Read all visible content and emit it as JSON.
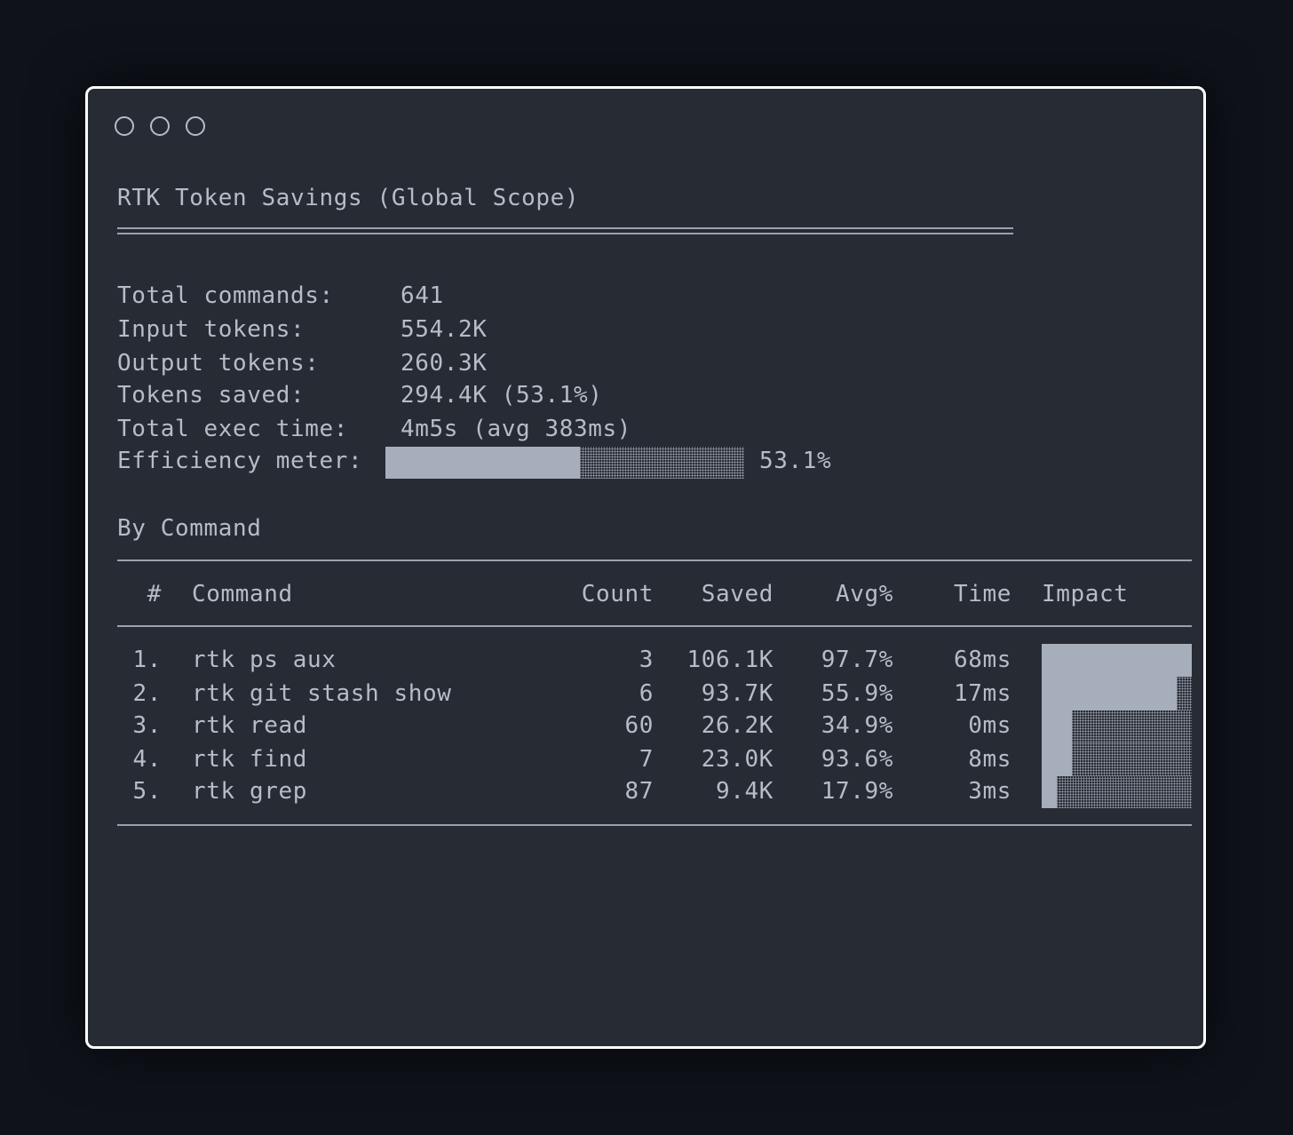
{
  "window": {
    "controls": [
      "close",
      "minimize",
      "maximize"
    ]
  },
  "title": "RTK Token Savings (Global Scope)",
  "summary": [
    {
      "label": "Total commands:",
      "value": "641"
    },
    {
      "label": "Input tokens:",
      "value": "554.2K"
    },
    {
      "label": "Output tokens:",
      "value": "260.3K"
    },
    {
      "label": "Tokens saved:",
      "value": "294.4K (53.1%)"
    },
    {
      "label": "Total exec time:",
      "value": "4m5s (avg 383ms)"
    }
  ],
  "efficiency": {
    "label": "Efficiency meter:",
    "fraction": 0.543,
    "value": "53.1%"
  },
  "section_title": "By Command",
  "table": {
    "headers": {
      "num": "#",
      "command": "Command",
      "count": "Count",
      "saved": "Saved",
      "avg": "Avg%",
      "time": "Time",
      "impact": "Impact"
    },
    "rows": [
      {
        "num": "1.",
        "command": "rtk ps aux",
        "count": "3",
        "saved": "106.1K",
        "avg": "97.7%",
        "time": "68ms",
        "impact": 1.0
      },
      {
        "num": "2.",
        "command": "rtk git stash show",
        "count": "6",
        "saved": "93.7K",
        "avg": "55.9%",
        "time": "17ms",
        "impact": 0.9
      },
      {
        "num": "3.",
        "command": "rtk read",
        "count": "60",
        "saved": "26.2K",
        "avg": "34.9%",
        "time": "0ms",
        "impact": 0.2
      },
      {
        "num": "4.",
        "command": "rtk find",
        "count": "7",
        "saved": "23.0K",
        "avg": "93.6%",
        "time": "8ms",
        "impact": 0.2
      },
      {
        "num": "5.",
        "command": "rtk grep",
        "count": "87",
        "saved": "9.4K",
        "avg": "17.9%",
        "time": "3ms",
        "impact": 0.1
      }
    ]
  },
  "colors": {
    "background": "#0f121a",
    "terminal": "#272b34",
    "text": "#b6bcc8",
    "bar": "#a7aebb"
  }
}
